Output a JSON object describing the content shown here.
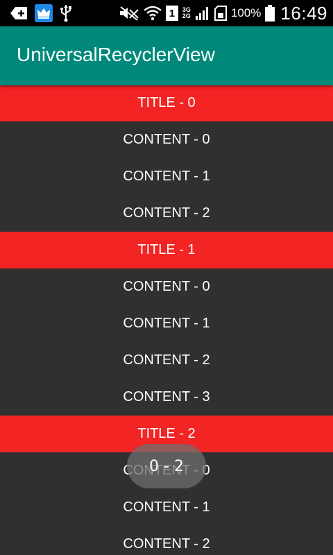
{
  "status_bar": {
    "battery_percent": "100%",
    "time": "16:49",
    "sim_slot": "1",
    "network_type_top": "3G",
    "network_type_bottom": "2G",
    "icons": [
      "add-notification-icon",
      "crown-app-icon",
      "usb-icon",
      "mute-icon",
      "wifi-icon",
      "sim-icon",
      "signal-icon",
      "sd-card-icon",
      "battery-icon"
    ]
  },
  "app_bar": {
    "title": "UniversalRecyclerView",
    "color": "#00897b"
  },
  "list": {
    "title_color": "#f22424",
    "items": [
      {
        "type": "title",
        "label": "TITLE - 0"
      },
      {
        "type": "content",
        "label": "CONTENT - 0"
      },
      {
        "type": "content",
        "label": "CONTENT - 1"
      },
      {
        "type": "content",
        "label": "CONTENT - 2"
      },
      {
        "type": "title",
        "label": "TITLE - 1"
      },
      {
        "type": "content",
        "label": "CONTENT - 0"
      },
      {
        "type": "content",
        "label": "CONTENT - 1"
      },
      {
        "type": "content",
        "label": "CONTENT - 2"
      },
      {
        "type": "content",
        "label": "CONTENT - 3"
      },
      {
        "type": "title",
        "label": "TITLE - 2"
      },
      {
        "type": "content",
        "label": "CONTENT - 0"
      },
      {
        "type": "content",
        "label": "CONTENT - 1"
      },
      {
        "type": "content",
        "label": "CONTENT - 2"
      }
    ]
  },
  "scroll_indicator": {
    "label": "0 - 2"
  }
}
